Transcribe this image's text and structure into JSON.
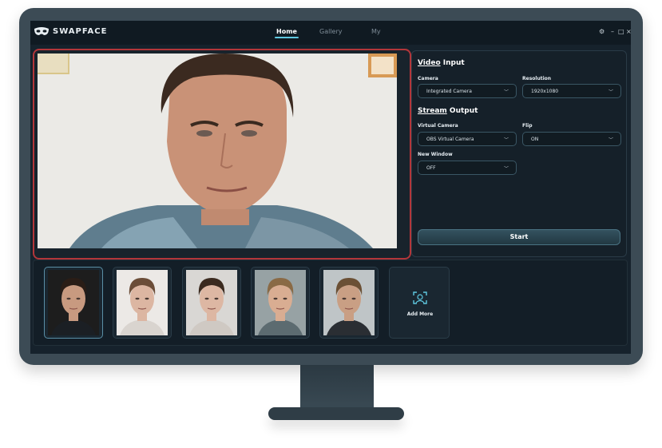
{
  "app": {
    "name": "SWAPFACE"
  },
  "nav": {
    "tabs": [
      {
        "label": "Home"
      },
      {
        "label": "Gallery"
      },
      {
        "label": "My"
      }
    ],
    "active": "Home"
  },
  "window_controls": {
    "settings": "⚙",
    "minimize": "–",
    "maximize": "□",
    "close": "×"
  },
  "video_input": {
    "title_prefix": "Video",
    "title_suffix": " Input",
    "camera": {
      "label": "Camera",
      "value": "Integrated Camera"
    },
    "resolution": {
      "label": "Resolution",
      "value": "1920x1080"
    }
  },
  "stream_output": {
    "title_prefix": "Stream",
    "title_suffix": " Output",
    "virtual_camera": {
      "label": "Virtual Camera",
      "value": "OBS Virtual Camera"
    },
    "flip": {
      "label": "Flip",
      "value": "ON"
    },
    "new_window": {
      "label": "New Window",
      "value": "OFF"
    }
  },
  "start_button": {
    "label": "Start"
  },
  "gallery": {
    "faces": [
      {
        "name": "face-1",
        "selected": true,
        "skin": "#c89a80",
        "hair": "#2a1d16",
        "bg": "#1d1d1d",
        "shirt": "#1b1f24"
      },
      {
        "name": "face-2",
        "selected": false,
        "skin": "#dcb6a2",
        "hair": "#6b4d38",
        "bg": "#ece9e6",
        "shirt": "#d9d4cf"
      },
      {
        "name": "face-3",
        "selected": false,
        "skin": "#ddb7a3",
        "hair": "#3b2a1f",
        "bg": "#d9d7d4",
        "shirt": "#cfc9c3"
      },
      {
        "name": "face-4",
        "selected": false,
        "skin": "#d9ad92",
        "hair": "#8a6a45",
        "bg": "#97a2a4",
        "shirt": "#5c6b70"
      },
      {
        "name": "face-5",
        "selected": false,
        "skin": "#c99f84",
        "hair": "#6b5035",
        "bg": "#bfc5c7",
        "shirt": "#2a2e33"
      }
    ],
    "add_more": {
      "label": "Add More"
    }
  },
  "colors": {
    "accent": "#5fc8e0",
    "highlight_border": "#b3363a",
    "screen_bg": "#16222c"
  }
}
